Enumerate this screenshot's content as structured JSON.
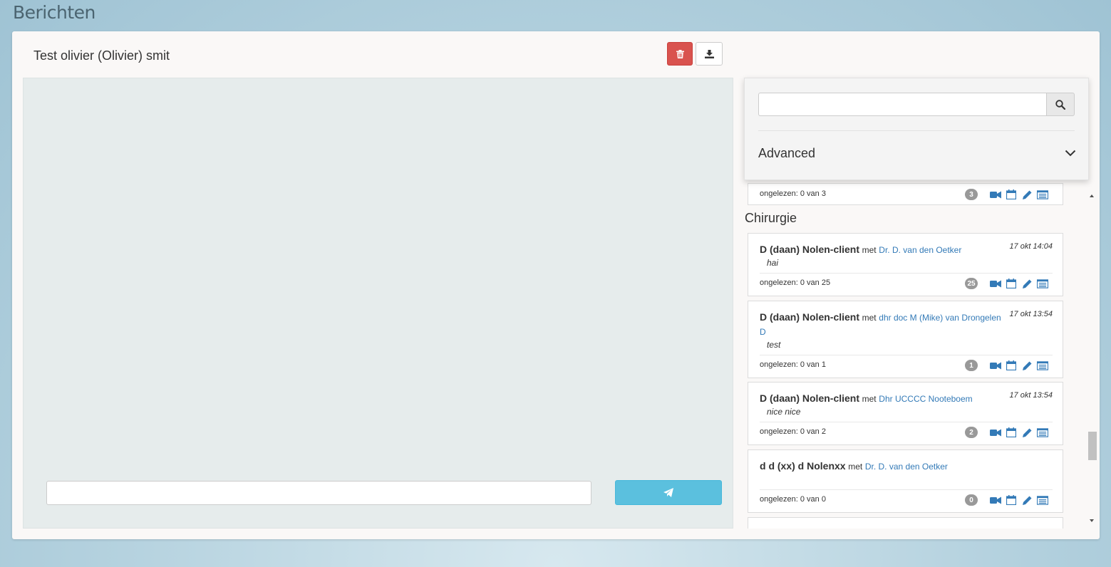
{
  "page": {
    "title": "Berichten"
  },
  "conversation": {
    "title": "Test olivier (Olivier) smit"
  },
  "composer": {
    "input_value": "",
    "input_placeholder": ""
  },
  "search": {
    "value": "",
    "placeholder": "",
    "advanced_label": "Advanced"
  },
  "partial_card": {
    "unread": "ongelezen: 0 van 3",
    "badge": "3"
  },
  "section": {
    "title": "Chirurgie"
  },
  "cards": [
    {
      "name": "D (daan) Nolen-client",
      "met": "met",
      "with": "Dr. D. van den Oetker",
      "time": "17 okt 14:04",
      "preview": "hai",
      "unread": "ongelezen: 0 van 25",
      "badge": "25"
    },
    {
      "name": "D (daan) Nolen-client",
      "met": "met",
      "with": "dhr doc M (Mike) van Drongelen D",
      "time": "17 okt 13:54",
      "preview": "test",
      "unread": "ongelezen: 0 van 1",
      "badge": "1"
    },
    {
      "name": "D (daan) Nolen-client",
      "met": "met",
      "with": "Dhr UCCCC Nooteboem",
      "time": "17 okt 13:54",
      "preview": "nice nice",
      "unread": "ongelezen: 0 van 2",
      "badge": "2"
    },
    {
      "name": "d d (xx) d Nolenxx",
      "met": "met",
      "with": "Dr. D. van den Oetker",
      "time": "",
      "preview": "",
      "unread": "ongelezen: 0 van 0",
      "badge": "0"
    }
  ],
  "colors": {
    "accent": "#337ab7",
    "danger": "#d9534f",
    "send": "#5bc0de",
    "badge": "#999999"
  },
  "icons": [
    "trash-icon",
    "download-icon",
    "send-icon",
    "search-icon",
    "chevron-down-icon",
    "video-icon",
    "calendar-icon",
    "pencil-icon",
    "list-icon"
  ]
}
